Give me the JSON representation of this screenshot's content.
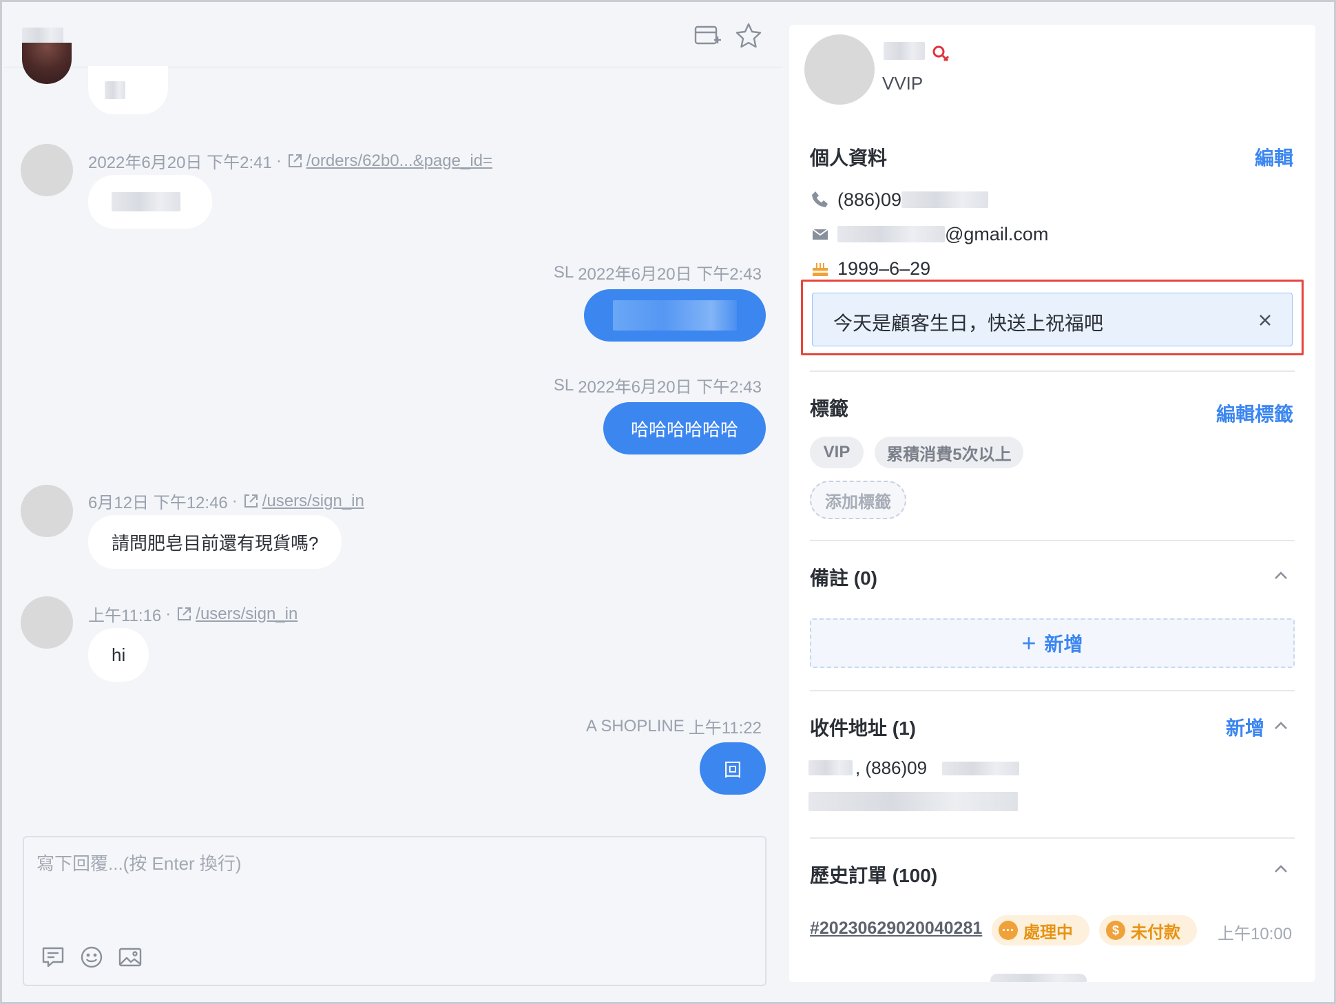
{
  "chat": {
    "messages": [
      {
        "meta_time": "2022年6月20日 下午2:41",
        "link": "/orders/62b0...&page_id="
      },
      {
        "sender": "SL",
        "time": "2022年6月20日 下午2:43"
      },
      {
        "sender": "SL",
        "time": "2022年6月20日 下午2:43",
        "text": "哈哈哈哈哈哈"
      },
      {
        "meta_time": "6月12日 下午12:46",
        "link": "/users/sign_in",
        "text": "請問肥皂目前還有現貨嗎?"
      },
      {
        "meta_time": "上午11:16",
        "link": "/users/sign_in",
        "text": "hi"
      },
      {
        "sender": "A SHOPLINE",
        "time": "上午11:22",
        "text": "回"
      }
    ],
    "meta_separator": "·",
    "composer": {
      "placeholder": "寫下回覆...(按 Enter 換行)"
    }
  },
  "header": {
    "icons": [
      "add-card-icon",
      "star-icon"
    ]
  },
  "customer": {
    "level": "VVIP",
    "profile": {
      "title": "個人資料",
      "edit": "編輯",
      "phone_prefix": "(886)09",
      "email_suffix": "@gmail.com",
      "birthday": "1999–6–29",
      "birthday_notice": "今天是顧客生日，快送上祝福吧"
    },
    "tags": {
      "title": "標籤",
      "edit": "編輯標籤",
      "items": [
        "VIP",
        "累積消費5次以上"
      ],
      "add": "添加標籤"
    },
    "notes": {
      "title": "備註 (0)",
      "add": "新增"
    },
    "address": {
      "title": "收件地址 (1)",
      "add": "新增",
      "phone_prefix": ", (886)09"
    },
    "orders": {
      "title": "歷史訂單 (100)",
      "items": [
        {
          "id": "#20230629020040281",
          "status": "處理中",
          "payment": "未付款",
          "time": "上午10:00"
        }
      ]
    }
  },
  "colors": {
    "accent": "#3c86f0",
    "highlight": "#e8453c",
    "badge": "#e79314"
  }
}
